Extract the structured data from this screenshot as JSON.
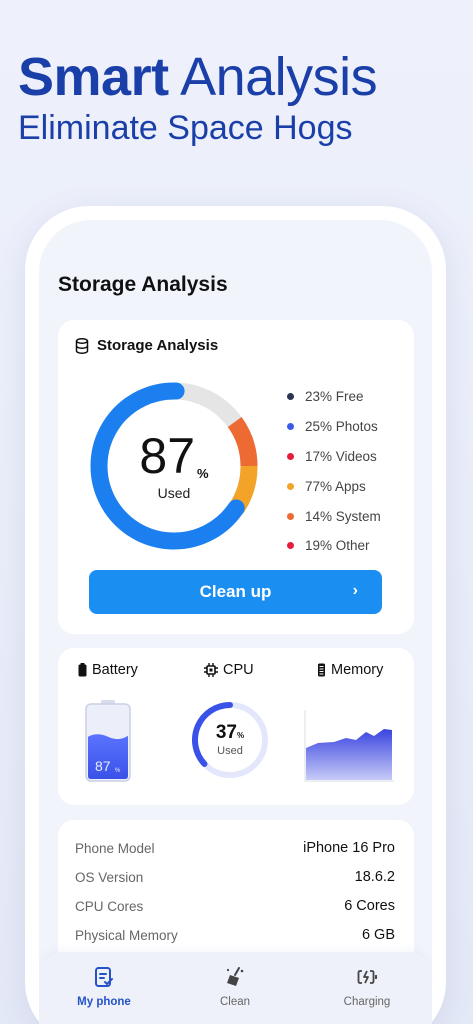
{
  "headline": {
    "bold": "Smart",
    "regular": "Analysis",
    "subtitle": "Eliminate Space Hogs"
  },
  "page_title": "Storage Analysis",
  "storage_card": {
    "title": "Storage Analysis",
    "used_value": "87",
    "used_unit": "%",
    "used_label": "Used",
    "used_fraction": 0.87,
    "legend": [
      {
        "label": "23% Free",
        "color": "#2b3450"
      },
      {
        "label": "25% Photos",
        "color": "#3b5be6"
      },
      {
        "label": "17% Videos",
        "color": "#e51d3b"
      },
      {
        "label": "77% Apps",
        "color": "#f2a328"
      },
      {
        "label": "14% System",
        "color": "#ee6a33"
      },
      {
        "label": "19% Other",
        "color": "#e51d3b"
      }
    ],
    "clean_button": "Clean up"
  },
  "metrics_card": {
    "battery_label": "Battery",
    "battery_value": "87",
    "battery_unit": "%",
    "battery_level": 0.6,
    "cpu_label": "CPU",
    "cpu_value": "37",
    "cpu_unit": "%",
    "cpu_used_label": "Used",
    "cpu_fraction": 0.37,
    "memory_label": "Memory"
  },
  "info_card": {
    "rows": [
      {
        "key": "Phone Model",
        "value": "iPhone 16 Pro"
      },
      {
        "key": "OS Version",
        "value": "18.6.2"
      },
      {
        "key": "CPU Cores",
        "value": "6 Cores"
      },
      {
        "key": "Physical Memory",
        "value": "6 GB"
      }
    ]
  },
  "tabbar": {
    "tabs": [
      {
        "label": "My phone",
        "icon": "phone-doc-icon",
        "active": true
      },
      {
        "label": "Clean",
        "icon": "broom-icon",
        "active": false
      },
      {
        "label": "Charging",
        "icon": "battery-charge-icon",
        "active": false
      }
    ]
  },
  "colors": {
    "brand": "#1a3fa8",
    "accent": "#1b8ef2",
    "donut_blue": "#1b7ff0",
    "donut_track": "#e5e5e5",
    "active_tab": "#2453c9"
  }
}
